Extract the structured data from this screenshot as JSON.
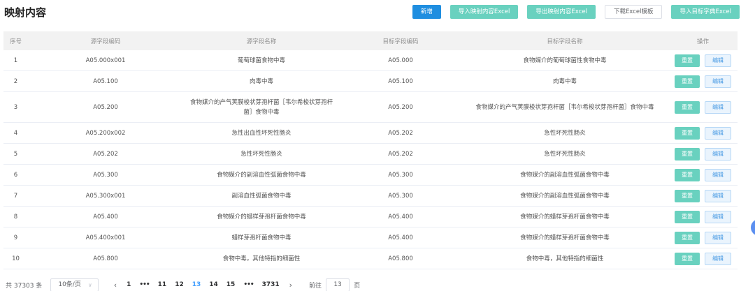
{
  "page": {
    "title": "映射内容"
  },
  "toolbar": {
    "add": "新增",
    "import_mapping": "导入映射内容Excel",
    "export_mapping": "导出映射内容Excel",
    "download_template": "下载Excel模板",
    "import_dictionary": "导入目标字典Excel"
  },
  "table": {
    "headers": [
      "序号",
      "源字段编码",
      "源字段名称",
      "目标字段编码",
      "目标字段名称",
      "操作"
    ],
    "reset_label": "重置",
    "edit_label": "编辑",
    "rows": [
      {
        "no": "1",
        "src_code": "A05.000x001",
        "src_name": "葡萄球菌食物中毒",
        "tgt_code": "A05.000",
        "tgt_name": "食物媒介的葡萄球菌性食物中毒"
      },
      {
        "no": "2",
        "src_code": "A05.100",
        "src_name": "肉毒中毒",
        "tgt_code": "A05.100",
        "tgt_name": "肉毒中毒"
      },
      {
        "no": "3",
        "src_code": "A05.200",
        "src_name": "食物媒介的产气荚膜梭状芽孢杆菌［韦尔希梭状芽孢杆菌］食物中毒",
        "tgt_code": "A05.200",
        "tgt_name": "食物媒介的产气荚膜梭状芽孢杆菌［韦尔希梭状芽孢杆菌］食物中毒"
      },
      {
        "no": "4",
        "src_code": "A05.200x002",
        "src_name": "急性出血性坏死性肠炎",
        "tgt_code": "A05.202",
        "tgt_name": "急性坏死性肠炎"
      },
      {
        "no": "5",
        "src_code": "A05.202",
        "src_name": "急性坏死性肠炎",
        "tgt_code": "A05.202",
        "tgt_name": "急性坏死性肠炎"
      },
      {
        "no": "6",
        "src_code": "A05.300",
        "src_name": "食物媒介的副溶血性弧菌食物中毒",
        "tgt_code": "A05.300",
        "tgt_name": "食物媒介的副溶血性弧菌食物中毒"
      },
      {
        "no": "7",
        "src_code": "A05.300x001",
        "src_name": "副溶血性弧菌食物中毒",
        "tgt_code": "A05.300",
        "tgt_name": "食物媒介的副溶血性弧菌食物中毒"
      },
      {
        "no": "8",
        "src_code": "A05.400",
        "src_name": "食物媒介的蜡样芽孢杆菌食物中毒",
        "tgt_code": "A05.400",
        "tgt_name": "食物媒介的蜡样芽孢杆菌食物中毒"
      },
      {
        "no": "9",
        "src_code": "A05.400x001",
        "src_name": "蜡样芽孢杆菌食物中毒",
        "tgt_code": "A05.400",
        "tgt_name": "食物媒介的蜡样芽孢杆菌食物中毒"
      },
      {
        "no": "10",
        "src_code": "A05.800",
        "src_name": "食物中毒，其他特指的细菌性",
        "tgt_code": "A05.800",
        "tgt_name": "食物中毒，其他特指的细菌性"
      }
    ]
  },
  "pagination": {
    "total": "共 37303 条",
    "page_size": "10条/页",
    "pages": [
      "1",
      "11",
      "12",
      "13",
      "14",
      "15",
      "3731"
    ],
    "current": "13",
    "ellipsis": "•••",
    "goto_label": "前往",
    "goto_value": "13",
    "page_suffix": "页"
  }
}
